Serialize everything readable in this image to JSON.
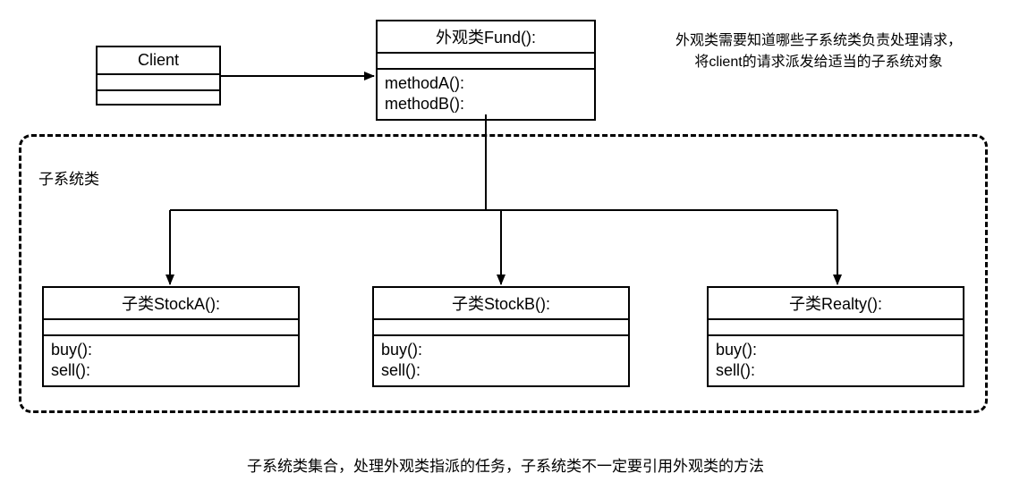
{
  "client": {
    "title": "Client"
  },
  "facade": {
    "title": "外观类Fund():",
    "methodA": "methodA():",
    "methodB": "methodB():"
  },
  "subsystemLabel": "子系统类",
  "stockA": {
    "title": "子类StockA():",
    "buy": "buy():",
    "sell": "sell():"
  },
  "stockB": {
    "title": "子类StockB():",
    "buy": "buy():",
    "sell": "sell():"
  },
  "realty": {
    "title": "子类Realty():",
    "buy": "buy():",
    "sell": "sell():"
  },
  "annotation": {
    "line1": "外观类需要知道哪些子系统类负责处理请求，",
    "line2": "将client的请求派发给适当的子系统对象"
  },
  "bottomCaption": "子系统类集合，处理外观类指派的任务，子系统类不一定要引用外观类的方法"
}
